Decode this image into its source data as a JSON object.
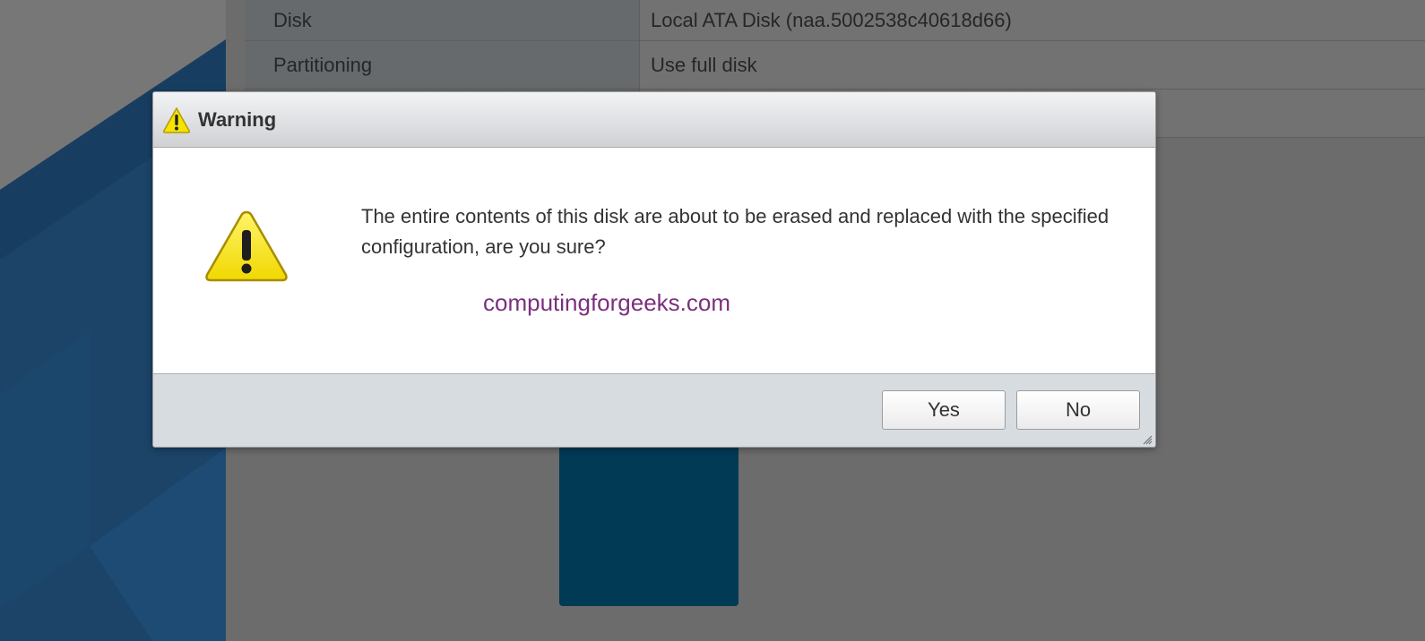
{
  "background": {
    "summary_rows": [
      {
        "key": "Disk",
        "value": "Local ATA Disk (naa.5002538c40618d66)"
      },
      {
        "key": "Partitioning",
        "value": "Use full disk"
      },
      {
        "key": "",
        "value": ""
      }
    ]
  },
  "dialog": {
    "title": "Warning",
    "title_icon": "warning-icon",
    "body_icon": "warning-icon",
    "message": "The entire contents of this disk are about to be erased and replaced with the specified configuration, are you sure?",
    "watermark": "computingforgeeks.com",
    "buttons": {
      "yes_label": "Yes",
      "no_label": "No"
    }
  },
  "colors": {
    "warning_yellow": "#f5e400",
    "watermark_purple": "#7b2f7e",
    "blue_accent": "#003a54"
  }
}
